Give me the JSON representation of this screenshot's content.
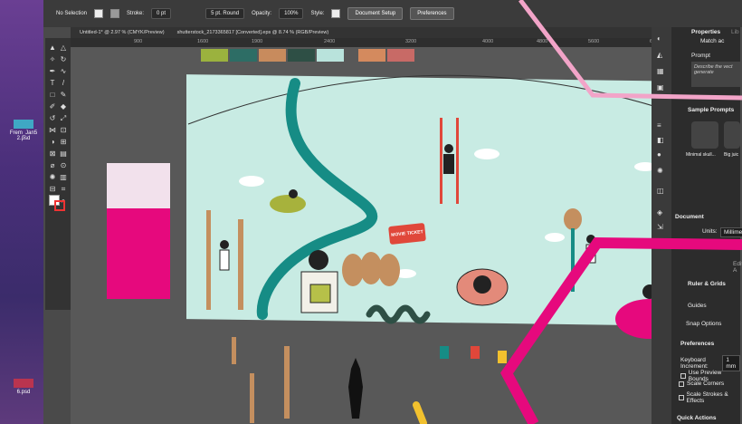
{
  "desktop": {
    "files": [
      {
        "label": "Frem_Jan5\n2.psd",
        "color": "#3fa8c4"
      },
      {
        "label": "6.psd",
        "color": "#b9344f"
      }
    ]
  },
  "control_bar": {
    "selection": "No Selection",
    "stroke_label": "Stroke:",
    "stroke_value": "0 pt",
    "brush": "5 pt. Round",
    "opacity_label": "Opacity:",
    "opacity_value": "100%",
    "style_label": "Style:",
    "doc_setup": "Document Setup",
    "preferences": "Preferences"
  },
  "tabs": [
    "Untitled-1* @ 2.97 % (CMYK/Preview)",
    "shutterstock_2173365817 [Converted].eps @ 8.74 % (RGB/Preview)"
  ],
  "ruler": [
    "900",
    "1600",
    "1900",
    "2400",
    "3200",
    "4000",
    "4800",
    "5600",
    "6400"
  ],
  "artboard": {
    "ticket_text": "MOVIE TICKET"
  },
  "panel": {
    "tab_properties": "Properties",
    "tab_lib": "Lib",
    "match_label": "Match ac",
    "prompt_label": "Prompt",
    "prompt_placeholder": "Describe the vect generate",
    "sample_prompts": "Sample Prompts",
    "samples": [
      "Minimal skull...",
      "Big juic"
    ],
    "document_label": "Document",
    "units_label": "Units:",
    "units_value": "Millime",
    "artboard_label": "Artboard:",
    "artboard_value": "1",
    "edit_label": "Edit A",
    "ruler_grids": "Ruler & Grids",
    "guides": "Guides",
    "snap_options": "Snap Options",
    "preferences": "Preferences",
    "keyboard_increment_label": "Keyboard Increment:",
    "keyboard_increment_value": "1 mm",
    "use_preview_bounds": "Use Preview Bounds",
    "scale_corners": "Scale Corners",
    "scale_strokes": "Scale Strokes & Effects",
    "quick_actions": "Quick Actions"
  },
  "colors": {
    "accent_pink": "#e6097d",
    "artboard_bg": "#c8ebe3",
    "teal_path": "#168c85",
    "overlay_pink": "#f2a4c8"
  }
}
